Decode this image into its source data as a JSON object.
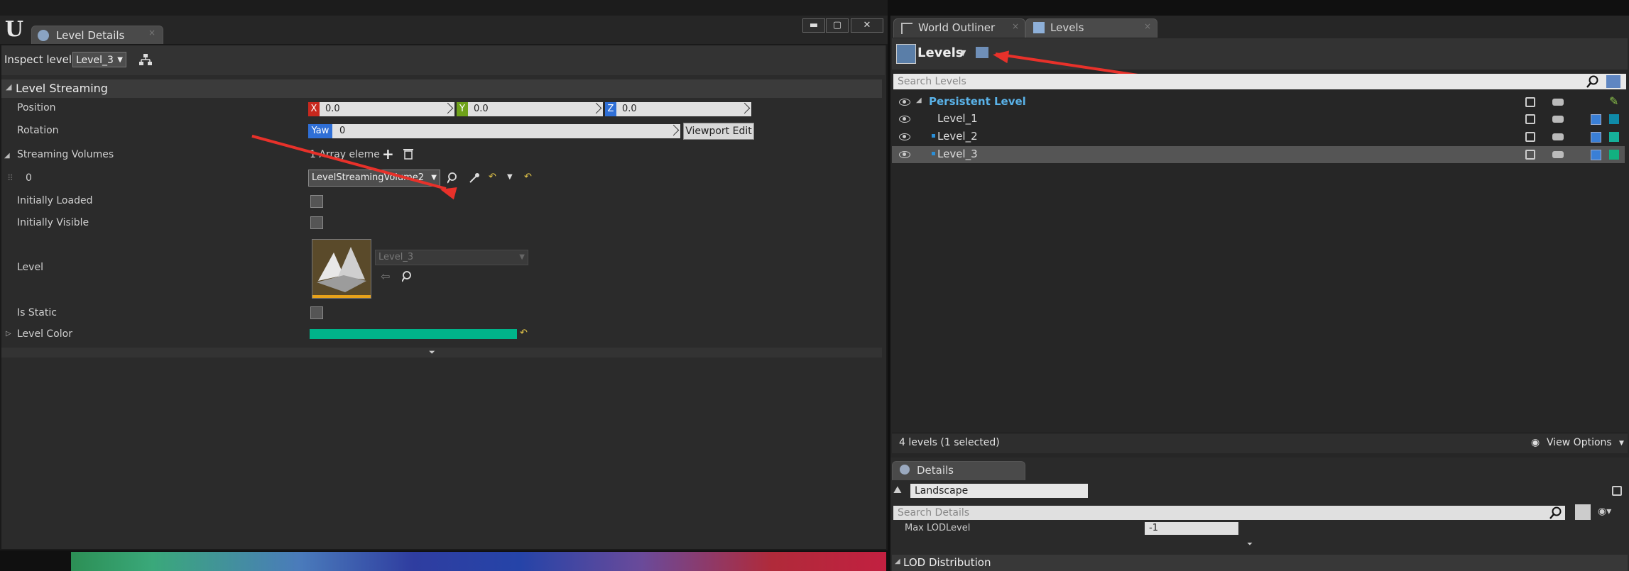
{
  "left_window": {
    "tab_title": "Level Details",
    "inspect_label": "Inspect level:",
    "inspect_value": "Level_3",
    "section_title": "Level Streaming",
    "properties": {
      "position_label": "Position",
      "position": {
        "x": "0.0",
        "y": "0.0",
        "z": "0.0"
      },
      "rotation_label": "Rotation",
      "yaw_label": "Yaw",
      "yaw_value": "0",
      "viewport_edit": "Viewport Edit",
      "streaming_volumes_label": "Streaming Volumes",
      "array_elements": "1 Array eleme",
      "index_label": "0",
      "volume_value": "LevelStreamingVolume2",
      "initially_loaded_label": "Initially Loaded",
      "initially_visible_label": "Initially Visible",
      "level_label": "Level",
      "level_value": "Level_3",
      "is_static_label": "Is Static",
      "level_color_label": "Level Color",
      "level_color": "#00b48a"
    },
    "axis_labels": {
      "x": "X",
      "y": "Y",
      "z": "Z"
    },
    "axis_colors": {
      "x": "#c8281e",
      "y": "#6fa21b",
      "z": "#2f6fd6"
    }
  },
  "right_panel": {
    "tabs": [
      {
        "label": "World Outliner"
      },
      {
        "label": "Levels"
      }
    ],
    "levels_title": "Levels",
    "search_placeholder": "Search Levels",
    "levels": [
      {
        "name": "Persistent Level",
        "color": "#1b8fd8"
      },
      {
        "name": "Level_1",
        "color": "#0f8aa8"
      },
      {
        "name": "Level_2",
        "color": "#16b09a"
      },
      {
        "name": "Level_3",
        "color": "#12b080"
      }
    ],
    "status": "4 levels (1 selected)",
    "view_options": "View Options",
    "details": {
      "tab_label": "Details",
      "object_name": "Landscape",
      "search_placeholder": "Search Details",
      "max_lod_label": "Max LODLevel",
      "max_lod_value": "-1",
      "lod_distribution": "LOD Distribution"
    }
  }
}
